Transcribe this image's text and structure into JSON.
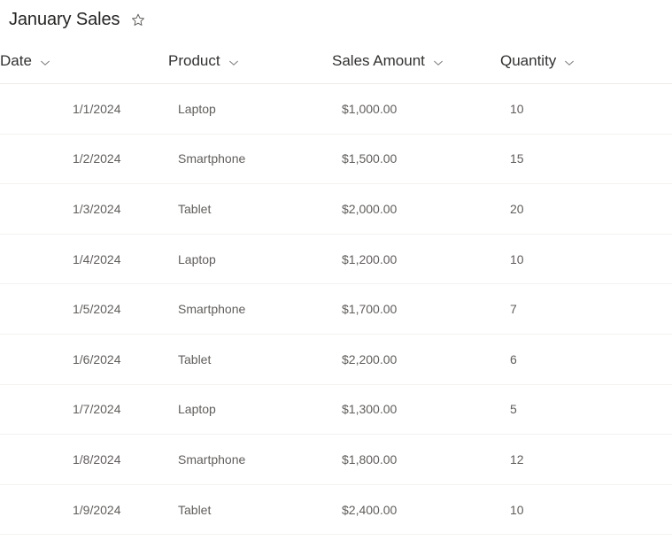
{
  "header": {
    "title": "January Sales",
    "favorite_icon": "star-outline-icon",
    "favorite_state": "not-favorited"
  },
  "colors": {
    "title_text": "#252423",
    "header_text": "#323130",
    "cell_text": "#605e5c",
    "header_divider": "#edebe9",
    "row_divider": "#f3f2f1",
    "background": "#ffffff"
  },
  "table": {
    "columns": [
      {
        "key": "date",
        "label": "Date",
        "sort_icon": "chevron-down-icon"
      },
      {
        "key": "product",
        "label": "Product",
        "sort_icon": "chevron-down-icon"
      },
      {
        "key": "amount",
        "label": "Sales Amount",
        "sort_icon": "chevron-down-icon"
      },
      {
        "key": "quantity",
        "label": "Quantity",
        "sort_icon": "chevron-down-icon"
      }
    ],
    "rows": [
      {
        "date": "1/1/2024",
        "product": "Laptop",
        "amount": "$1,000.00",
        "quantity": "10"
      },
      {
        "date": "1/2/2024",
        "product": "Smartphone",
        "amount": "$1,500.00",
        "quantity": "15"
      },
      {
        "date": "1/3/2024",
        "product": "Tablet",
        "amount": "$2,000.00",
        "quantity": "20"
      },
      {
        "date": "1/4/2024",
        "product": "Laptop",
        "amount": "$1,200.00",
        "quantity": "10"
      },
      {
        "date": "1/5/2024",
        "product": "Smartphone",
        "amount": "$1,700.00",
        "quantity": "7"
      },
      {
        "date": "1/6/2024",
        "product": "Tablet",
        "amount": "$2,200.00",
        "quantity": "6"
      },
      {
        "date": "1/7/2024",
        "product": "Laptop",
        "amount": "$1,300.00",
        "quantity": "5"
      },
      {
        "date": "1/8/2024",
        "product": "Smartphone",
        "amount": "$1,800.00",
        "quantity": "12"
      },
      {
        "date": "1/9/2024",
        "product": "Tablet",
        "amount": "$2,400.00",
        "quantity": "10"
      }
    ]
  }
}
